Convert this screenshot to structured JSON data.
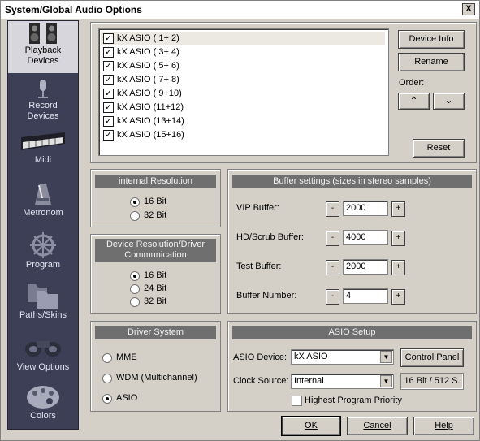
{
  "window": {
    "title": "System/Global Audio Options",
    "close_glyph": "X"
  },
  "sidebar": {
    "items": [
      {
        "label_line1": "Playback",
        "label_line2": "Devices",
        "active": true,
        "icon": "speakers-icon"
      },
      {
        "label_line1": "Record",
        "label_line2": "Devices",
        "active": false,
        "icon": "microphone-icon"
      },
      {
        "label_line1": "Midi",
        "label_line2": "",
        "active": false,
        "icon": "keyboard-icon"
      },
      {
        "label_line1": "Metronom",
        "label_line2": "",
        "active": false,
        "icon": "metronome-icon"
      },
      {
        "label_line1": "Program",
        "label_line2": "",
        "active": false,
        "icon": "ship-wheel-icon"
      },
      {
        "label_line1": "Paths/Skins",
        "label_line2": "",
        "active": false,
        "icon": "folders-icon"
      },
      {
        "label_line1": "View Options",
        "label_line2": "",
        "active": false,
        "icon": "binoculars-icon"
      },
      {
        "label_line1": "Colors",
        "label_line2": "",
        "active": false,
        "icon": "palette-icon"
      }
    ]
  },
  "devices": {
    "items": [
      {
        "label": "kX ASIO ( 1+ 2)",
        "checked": true
      },
      {
        "label": "kX ASIO ( 3+ 4)",
        "checked": true
      },
      {
        "label": "kX ASIO ( 5+ 6)",
        "checked": true
      },
      {
        "label": "kX ASIO ( 7+ 8)",
        "checked": true
      },
      {
        "label": "kX ASIO ( 9+10)",
        "checked": true
      },
      {
        "label": "kX ASIO (11+12)",
        "checked": true
      },
      {
        "label": "kX ASIO (13+14)",
        "checked": true
      },
      {
        "label": "kX ASIO (15+16)",
        "checked": true
      }
    ],
    "check_glyph": "✓",
    "device_info_label": "Device Info",
    "rename_label": "Rename",
    "order_label": "Order:",
    "up_glyph": "⌃",
    "down_glyph": "⌄",
    "reset_label": "Reset"
  },
  "internal_resolution": {
    "title": "internal Resolution",
    "options": [
      "16 Bit",
      "32 Bit"
    ],
    "selected": 0
  },
  "device_resolution": {
    "title_line1": "Device Resolution/Driver",
    "title_line2": "Communication",
    "options": [
      "16 Bit",
      "24 Bit",
      "32 Bit"
    ],
    "selected": 0
  },
  "buffer_settings": {
    "title": "Buffer settings (sizes in stereo samples)",
    "minus_glyph": "-",
    "plus_glyph": "+",
    "rows": [
      {
        "label": "VIP Buffer:",
        "value": "2000"
      },
      {
        "label": "HD/Scrub Buffer:",
        "value": "4000"
      },
      {
        "label": "Test Buffer:",
        "value": "2000"
      },
      {
        "label": "Buffer Number:",
        "value": "4"
      }
    ]
  },
  "driver_system": {
    "title": "Driver System",
    "options": [
      "MME",
      "WDM (Multichannel)",
      "ASIO"
    ],
    "selected": 2
  },
  "asio_setup": {
    "title": "ASIO Setup",
    "device_label": "ASIO Device:",
    "device_value": "kX ASIO",
    "control_panel_label": "Control Panel",
    "clock_label": "Clock Source:",
    "clock_value": "Internal",
    "status_readout": "16 Bit / 512 S.",
    "priority_label": "Highest Program Priority",
    "priority_checked": false,
    "dropdown_glyph": "▼"
  },
  "footer": {
    "ok_label": "OK",
    "cancel_label": "Cancel",
    "help_label": "Help"
  }
}
